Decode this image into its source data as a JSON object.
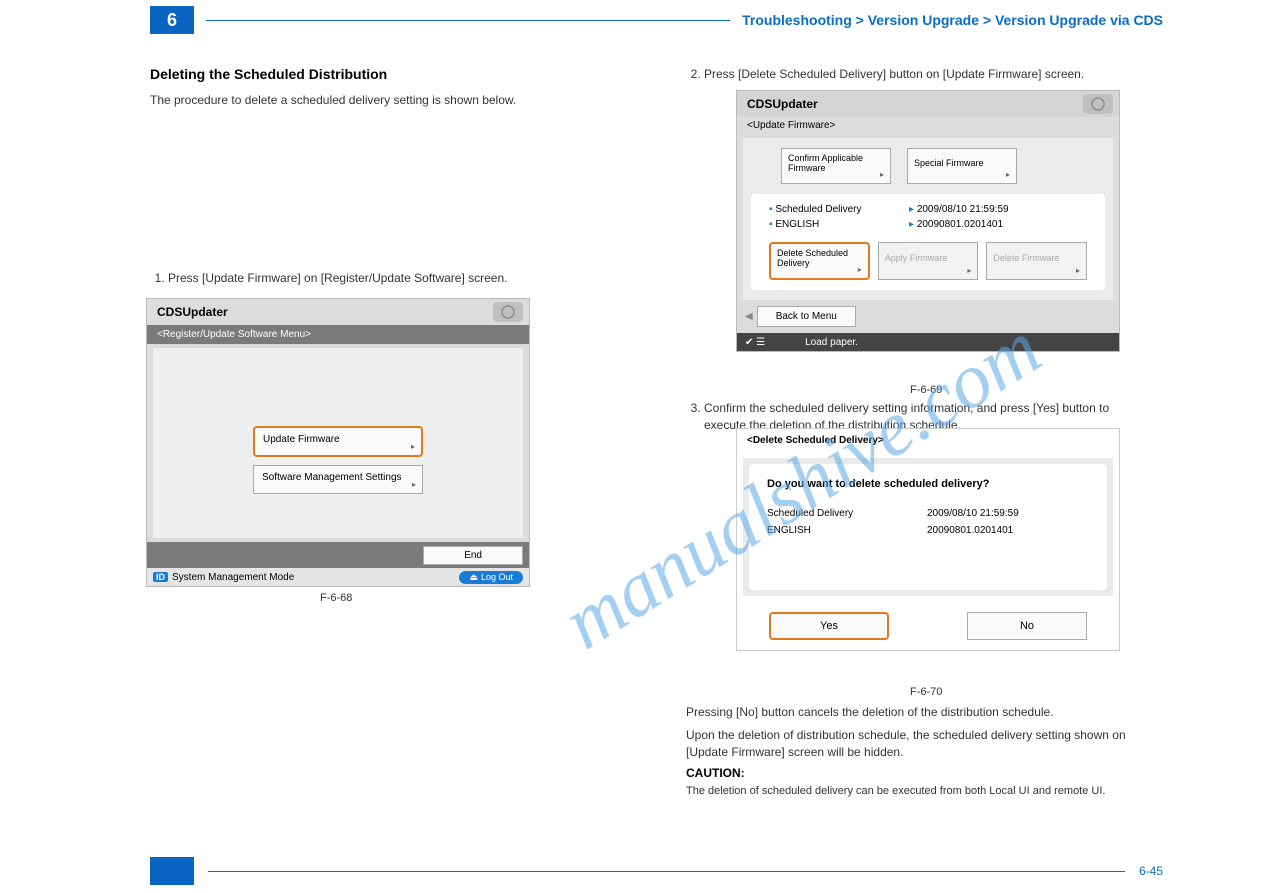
{
  "header": {
    "number": "6",
    "title": "Troubleshooting > Version Upgrade > Version Upgrade via CDS"
  },
  "section": {
    "heading": "Deleting the Scheduled Distribution",
    "intro": "The procedure to delete a scheduled delivery setting is shown below.",
    "steps": [
      "Press [Update Firmware] on [Register/Update Software] screen.",
      "Press [Delete Scheduled Delivery] button on [Update Firmware] screen.",
      "Confirm the scheduled delivery setting information, and press [Yes] button to execute the deletion of the distribution schedule."
    ],
    "note_after_step3": "Pressing [No] button cancels the deletion of the distribution schedule.",
    "after_fig3": "Upon the deletion of distribution schedule, the scheduled delivery setting shown on [Update Firmware] screen will be hidden.",
    "caution_label": "CAUTION:",
    "caution_text": "The deletion of scheduled delivery can be executed from both Local UI and remote UI."
  },
  "panel1": {
    "title": "CDSUpdater",
    "subtitle": "<Register/Update Software Menu>",
    "btn_update": "Update Firmware",
    "btn_sm": "Software Management Settings",
    "end": "End",
    "status_left": "System Management Mode",
    "logout": "Log Out",
    "fig": "F-6-68"
  },
  "panel2": {
    "title": "CDSUpdater",
    "sub": "<Update Firmware>",
    "btn_confirm": "Confirm Applicable Firmware",
    "btn_special": "Special Firmware",
    "info": {
      "scheduled_label": "Scheduled Delivery",
      "scheduled_val": "2009/08/10 21:59:59",
      "lang_label": "ENGLISH",
      "lang_val": "20090801.0201401"
    },
    "btn_delete": "Delete Scheduled Delivery",
    "btn_apply": "Apply Firmware",
    "btn_delfw": "Delete Firmware",
    "back": "Back to Menu",
    "status": "Load paper.",
    "fig": "F-6-69"
  },
  "panel3": {
    "title": "<Delete Scheduled Delivery>",
    "question": "Do you want to delete scheduled delivery?",
    "row1_l": "Scheduled Delivery",
    "row1_v": "2009/08/10 21:59:59",
    "row2_l": "ENGLISH",
    "row2_v": "20090801.0201401",
    "yes": "Yes",
    "no": "No",
    "fig": "F-6-70"
  },
  "footer": {
    "page": "6-45"
  }
}
